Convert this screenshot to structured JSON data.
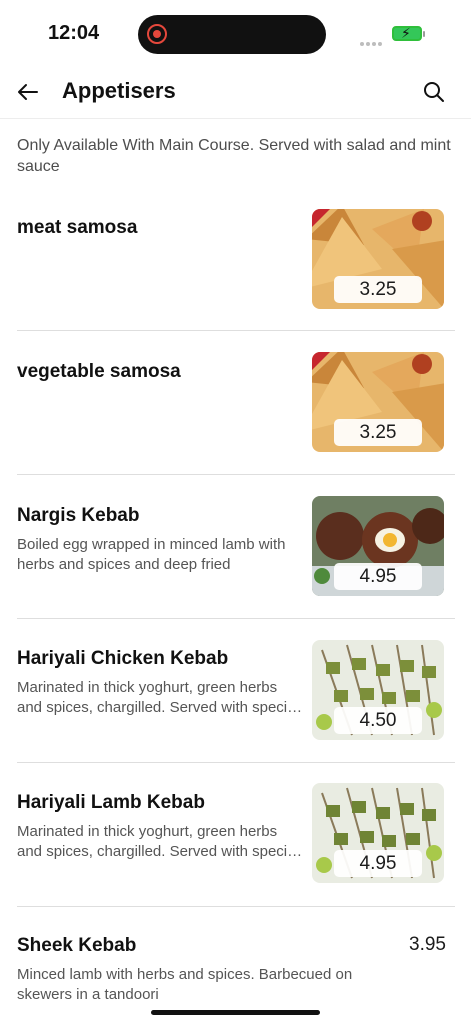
{
  "status_bar": {
    "time": "12:04"
  },
  "header": {
    "title": "Appetisers"
  },
  "intro": "Only Available With Main Course. Served with salad and mint sauce",
  "items": [
    {
      "name": "meat samosa",
      "price": "3.25"
    },
    {
      "name": "vegetable samosa",
      "price": "3.25"
    },
    {
      "name": "Nargis Kebab",
      "description": "Boiled egg wrapped in minced lamb with herbs and spices and deep fried",
      "price": "4.95"
    },
    {
      "name": "Hariyali Chicken Kebab",
      "description_line1": "Marinated in thick yoghurt, green herbs",
      "description_line2": "and spices, chargilled. Served with speci…",
      "price": "4.50"
    },
    {
      "name": "Hariyali Lamb Kebab",
      "description_line1": "Marinated in thick yoghurt, green herbs",
      "description_line2": "and spices, chargilled. Served with speci…",
      "price": "4.95"
    },
    {
      "name": "Sheek Kebab",
      "description": "Minced lamb with herbs and spices. Barbecued on skewers in a tandoori",
      "price": "3.95"
    }
  ]
}
